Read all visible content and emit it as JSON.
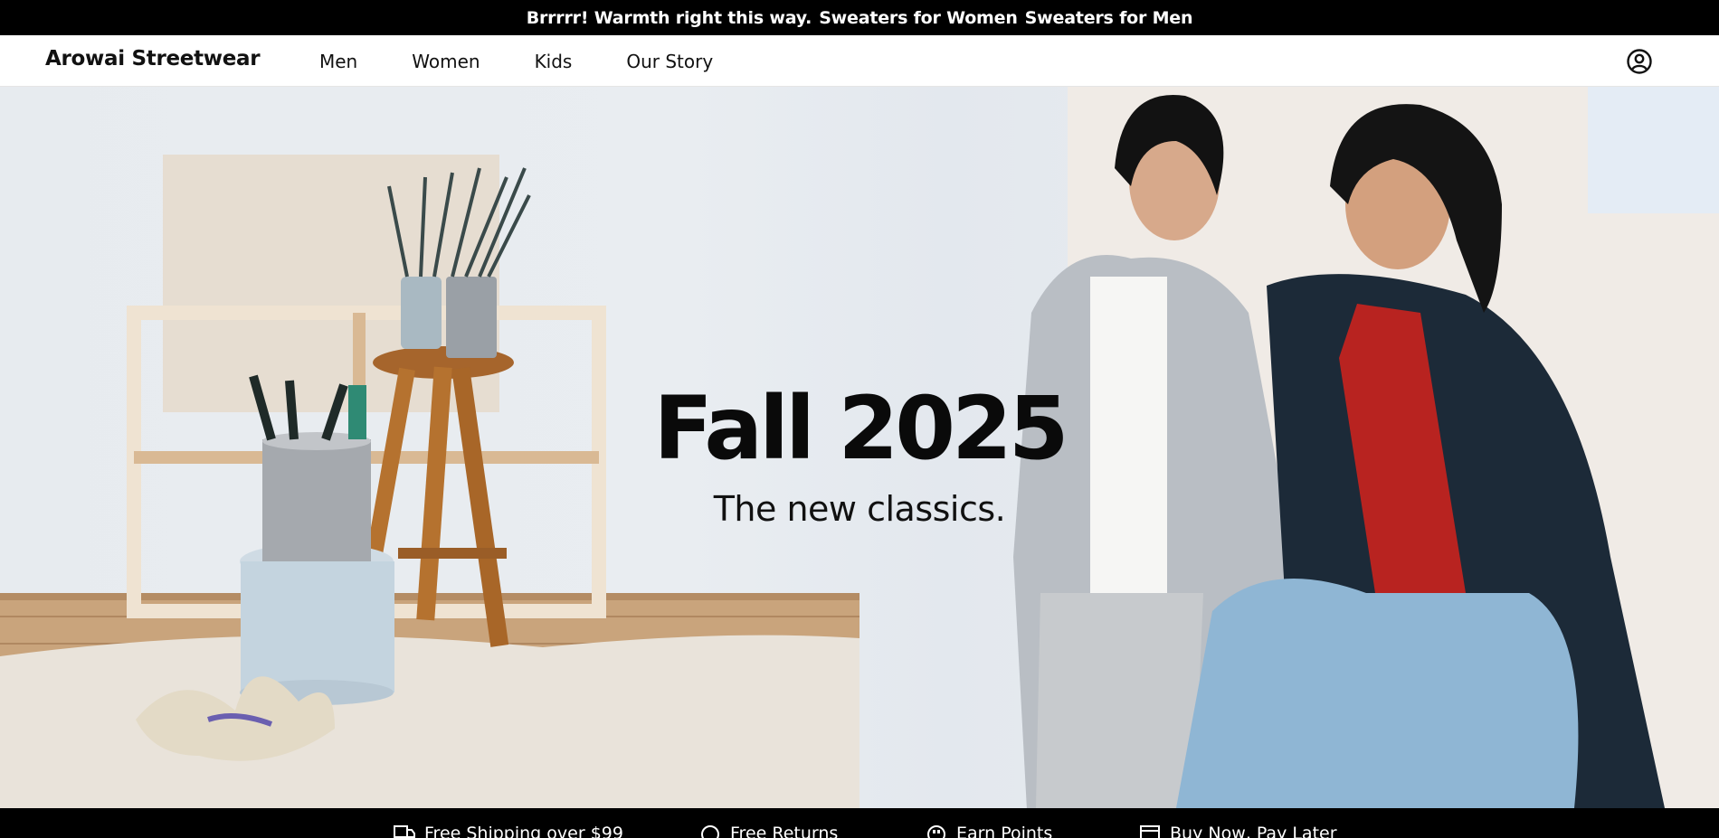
{
  "promo": {
    "message": "Brrrrr! Warmth right this way.",
    "links": [
      "Sweaters for Women",
      "Sweaters for Men"
    ]
  },
  "header": {
    "brand": "Arowai Streetwear",
    "nav": [
      "Men",
      "Women",
      "Kids",
      "Our Story"
    ],
    "account_icon": "user-circle-icon"
  },
  "hero": {
    "title": "Fall 2025",
    "subtitle": "The new classics."
  },
  "perks": [
    {
      "icon": "truck-icon",
      "label": "Free Shipping over $99"
    },
    {
      "icon": "returns-icon",
      "label": "Free Returns"
    },
    {
      "icon": "points-icon",
      "label": "Earn Points"
    },
    {
      "icon": "card-icon",
      "label": "Buy Now, Pay Later"
    }
  ],
  "colors": {
    "bar_background": "#000000",
    "bar_text": "#ffffff",
    "text": "#111111"
  }
}
